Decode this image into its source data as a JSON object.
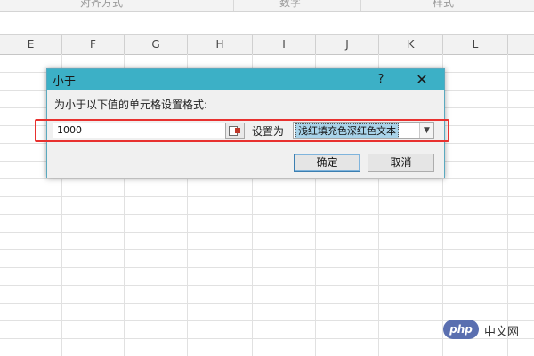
{
  "ribbon": {
    "groups": [
      "对齐方式",
      "数字",
      "样式"
    ]
  },
  "columns": [
    "E",
    "F",
    "G",
    "H",
    "I",
    "J",
    "K",
    "L"
  ],
  "dialog": {
    "title": "小于",
    "help_label": "?",
    "close_label": "✕",
    "prompt": "为小于以下值的单元格设置格式:",
    "value": "1000",
    "set_as_label": "设置为",
    "format_selected": "浅红填充色深红色文本",
    "ok_label": "确定",
    "cancel_label": "取消"
  },
  "watermark": {
    "logo_text": "php",
    "site_text": "中文网"
  },
  "colors": {
    "titlebar": "#3cb0c6",
    "highlight_border": "#e8312f",
    "selection": "#a9d3e9"
  }
}
